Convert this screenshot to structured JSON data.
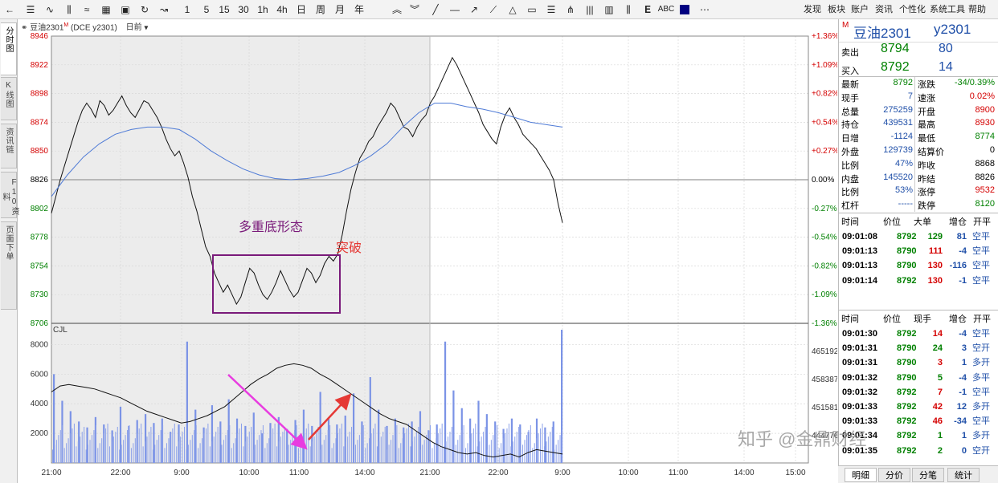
{
  "toolbar": {
    "timeframes": [
      "1",
      "5",
      "15",
      "30",
      "1h",
      "4h",
      "日",
      "周",
      "月",
      "年"
    ],
    "abc_label": "ABC",
    "menu": [
      "发现",
      "板块",
      "账户",
      "资讯",
      "个性化",
      "系统工具",
      "帮助"
    ]
  },
  "left_tabs": [
    "分时图",
    "K线图",
    "资讯链",
    "F10资料",
    "页面下单"
  ],
  "chart_header": {
    "contract": "豆油2301",
    "marker": "M",
    "code": "(DCE y2301)",
    "period": "日前"
  },
  "price_axis": {
    "left_ticks": [
      "8946",
      "8922",
      "8898",
      "8874",
      "8850",
      "8826",
      "8802",
      "8778",
      "8754",
      "8730",
      "8706"
    ],
    "right_ticks": [
      "+1.36%",
      "+1.09%",
      "+0.82%",
      "+0.54%",
      "+0.27%",
      "0.00%",
      "-0.27%",
      "-0.54%",
      "-0.82%",
      "-1.09%",
      "-1.36%"
    ],
    "prev_settle": 8826
  },
  "volume_axis": {
    "label": "CJL",
    "left_ticks": [
      "8000",
      "6000",
      "4000",
      "2000"
    ],
    "right_ticks": [
      "465192",
      "458387",
      "451581",
      "444776"
    ]
  },
  "time_axis": [
    "21:00",
    "22:00",
    "9:00",
    "10:00",
    "11:00",
    "14:00",
    "21:00",
    "22:00",
    "9:00",
    "10:00",
    "11:00",
    "14:00",
    "15:00"
  ],
  "annotations": {
    "pattern_label": "多重底形态",
    "breakout_label": "突破",
    "colors": {
      "pattern": "#7a1a7a",
      "breakout": "#e53935",
      "down_arrow": "#e83ce0",
      "up_arrow": "#e53935"
    }
  },
  "chart_data": {
    "type": "line",
    "title": "",
    "price_series_name": "",
    "ylim": [
      8706,
      8946
    ],
    "price": [
      8798,
      8812,
      8826,
      8838,
      8850,
      8862,
      8874,
      8884,
      8890,
      8885,
      8878,
      8892,
      8888,
      8880,
      8884,
      8890,
      8896,
      8888,
      8882,
      8878,
      8885,
      8892,
      8890,
      8884,
      8878,
      8870,
      8860,
      8852,
      8846,
      8850,
      8840,
      8828,
      8812,
      8800,
      8785,
      8770,
      8762,
      8748,
      8740,
      8732,
      8738,
      8730,
      8722,
      8728,
      8740,
      8752,
      8748,
      8738,
      8730,
      8726,
      8732,
      8740,
      8750,
      8742,
      8734,
      8728,
      8732,
      8742,
      8752,
      8748,
      8740,
      8746,
      8756,
      8762,
      8758,
      8764,
      8780,
      8800,
      8818,
      8832,
      8844,
      8850,
      8858,
      8862,
      8870,
      8876,
      8882,
      8890,
      8886,
      8878,
      8870,
      8868,
      8862,
      8870,
      8876,
      8880,
      8890,
      8896,
      8904,
      8912,
      8920,
      8928,
      8922,
      8914,
      8906,
      8898,
      8890,
      8882,
      8872,
      8866,
      8860,
      8856,
      8870,
      8880,
      8886,
      8878,
      8872,
      8864,
      8860,
      8856,
      8852,
      8846,
      8840,
      8834,
      8826,
      8806,
      8790
    ],
    "price_note": "",
    "avg_line": [
      8812,
      8830,
      8845,
      8856,
      8864,
      8868,
      8870,
      8870,
      8868,
      8860,
      8850,
      8842,
      8835,
      8830,
      8827,
      8826,
      8827,
      8829,
      8832,
      8838,
      8846,
      8856,
      8870,
      8882,
      8890,
      8890,
      8887,
      8885,
      8882,
      8878,
      8874,
      8872,
      8870
    ],
    "volume": [
      6000,
      4200,
      3500,
      2800,
      2400,
      3100,
      2600,
      2200,
      3800,
      2500,
      2900,
      3300,
      2700,
      3000,
      2100,
      2600,
      8200,
      3600,
      2400,
      3900,
      2800,
      4300,
      3000,
      2500,
      3400,
      2000,
      2700,
      3100,
      2300,
      2900,
      3600,
      2500,
      4800,
      3000,
      2600,
      3200,
      4700,
      2800,
      5800,
      3600,
      2500,
      3000,
      2400,
      2800,
      3500,
      2200,
      2600,
      8200,
      4900,
      3700,
      3000,
      4200,
      3300,
      2800,
      2300,
      3000,
      2600,
      2100,
      3000,
      2400,
      2800,
      9000
    ],
    "open_interest": [
      4800,
      5200,
      5300,
      5200,
      5100,
      5000,
      4800,
      4600,
      4400,
      4100,
      3800,
      3500,
      3300,
      3100,
      2900,
      2700,
      2800,
      3000,
      3200,
      3500,
      3800,
      4300,
      4800,
      5300,
      5700,
      6000,
      6400,
      6600,
      6700,
      6600,
      6400,
      6000,
      5700,
      5300,
      4900,
      4500,
      4100,
      3700,
      3300,
      3000,
      2800,
      2600,
      2200,
      1800,
      1400,
      1100,
      900,
      700,
      600,
      700,
      500,
      400,
      500,
      600,
      400,
      700,
      900,
      800,
      700,
      600
    ]
  },
  "right_panel": {
    "marker": "M",
    "name": "豆油2301",
    "code": "y2301",
    "ask_label": "卖出",
    "ask_price": "8794",
    "ask_qty": "80",
    "bid_label": "买入",
    "bid_price": "8792",
    "bid_qty": "14",
    "stats_left": [
      {
        "label": "最新",
        "value": "8792",
        "color": "green"
      },
      {
        "label": "现手",
        "value": "7",
        "color": "blue"
      },
      {
        "label": "总量",
        "value": "275259",
        "color": "blue"
      },
      {
        "label": "持仓",
        "value": "439531",
        "color": "blue"
      },
      {
        "label": "日增",
        "value": "-1124",
        "color": "blue"
      },
      {
        "label": "外盘",
        "value": "129739",
        "color": "blue"
      },
      {
        "label": "比例",
        "value": "47%",
        "color": "blue"
      },
      {
        "label": "内盘",
        "value": "145520",
        "color": "blue"
      },
      {
        "label": "比例",
        "value": "53%",
        "color": "blue"
      },
      {
        "label": "杠杆",
        "value": "-----",
        "color": "blue"
      }
    ],
    "stats_right": [
      {
        "label": "涨跌",
        "value": "-34/0.39%",
        "color": "green"
      },
      {
        "label": "速涨",
        "value": "0.02%",
        "color": "red"
      },
      {
        "label": "开盘",
        "value": "8900",
        "color": "red"
      },
      {
        "label": "最高",
        "value": "8930",
        "color": "red"
      },
      {
        "label": "最低",
        "value": "8774",
        "color": "green"
      },
      {
        "label": "结算价",
        "value": "0",
        "color": "black"
      },
      {
        "label": "昨收",
        "value": "8868",
        "color": "black"
      },
      {
        "label": "昨结",
        "value": "8826",
        "color": "black"
      },
      {
        "label": "涨停",
        "value": "9532",
        "color": "red"
      },
      {
        "label": "跌停",
        "value": "8120",
        "color": "green"
      }
    ],
    "ticks1_header": [
      "时间",
      "价位",
      "大单",
      "增仓",
      "开平"
    ],
    "ticks1": [
      {
        "time": "09:01:08",
        "price": "8792",
        "vol": "129",
        "oi": "81",
        "type": "空平",
        "vc": "green",
        "oc": "blue"
      },
      {
        "time": "09:01:13",
        "price": "8790",
        "vol": "111",
        "oi": "-4",
        "type": "空平",
        "vc": "red",
        "oc": "blue"
      },
      {
        "time": "09:01:13",
        "price": "8790",
        "vol": "130",
        "oi": "-116",
        "type": "空平",
        "vc": "red",
        "oc": "blue"
      },
      {
        "time": "09:01:14",
        "price": "8792",
        "vol": "130",
        "oi": "-1",
        "type": "空平",
        "vc": "red",
        "oc": "blue"
      }
    ],
    "ticks2_header": [
      "时间",
      "价位",
      "现手",
      "增仓",
      "开平"
    ],
    "ticks2": [
      {
        "time": "09:01:30",
        "price": "8792",
        "vol": "14",
        "oi": "-4",
        "type": "空平",
        "vc": "red",
        "oc": "blue"
      },
      {
        "time": "09:01:31",
        "price": "8790",
        "vol": "24",
        "oi": "3",
        "type": "空开",
        "vc": "green",
        "oc": "blue"
      },
      {
        "time": "09:01:31",
        "price": "8790",
        "vol": "3",
        "oi": "1",
        "type": "多开",
        "vc": "red",
        "oc": "blue"
      },
      {
        "time": "09:01:32",
        "price": "8790",
        "vol": "5",
        "oi": "-4",
        "type": "多平",
        "vc": "green",
        "oc": "blue"
      },
      {
        "time": "09:01:32",
        "price": "8792",
        "vol": "7",
        "oi": "-1",
        "type": "空平",
        "vc": "red",
        "oc": "blue"
      },
      {
        "time": "09:01:33",
        "price": "8792",
        "vol": "42",
        "oi": "12",
        "type": "多开",
        "vc": "red",
        "oc": "blue"
      },
      {
        "time": "09:01:33",
        "price": "8792",
        "vol": "46",
        "oi": "-34",
        "type": "空平",
        "vc": "red",
        "oc": "blue"
      },
      {
        "time": "09:01:34",
        "price": "8792",
        "vol": "1",
        "oi": "1",
        "type": "多开",
        "vc": "green",
        "oc": "blue"
      },
      {
        "time": "09:01:35",
        "price": "8792",
        "vol": "2",
        "oi": "0",
        "type": "空开",
        "vc": "green",
        "oc": "blue"
      }
    ]
  },
  "bottom_tabs": [
    "明细",
    "分价",
    "分笔",
    "统计"
  ],
  "watermark": "知乎 @金鼎财经"
}
